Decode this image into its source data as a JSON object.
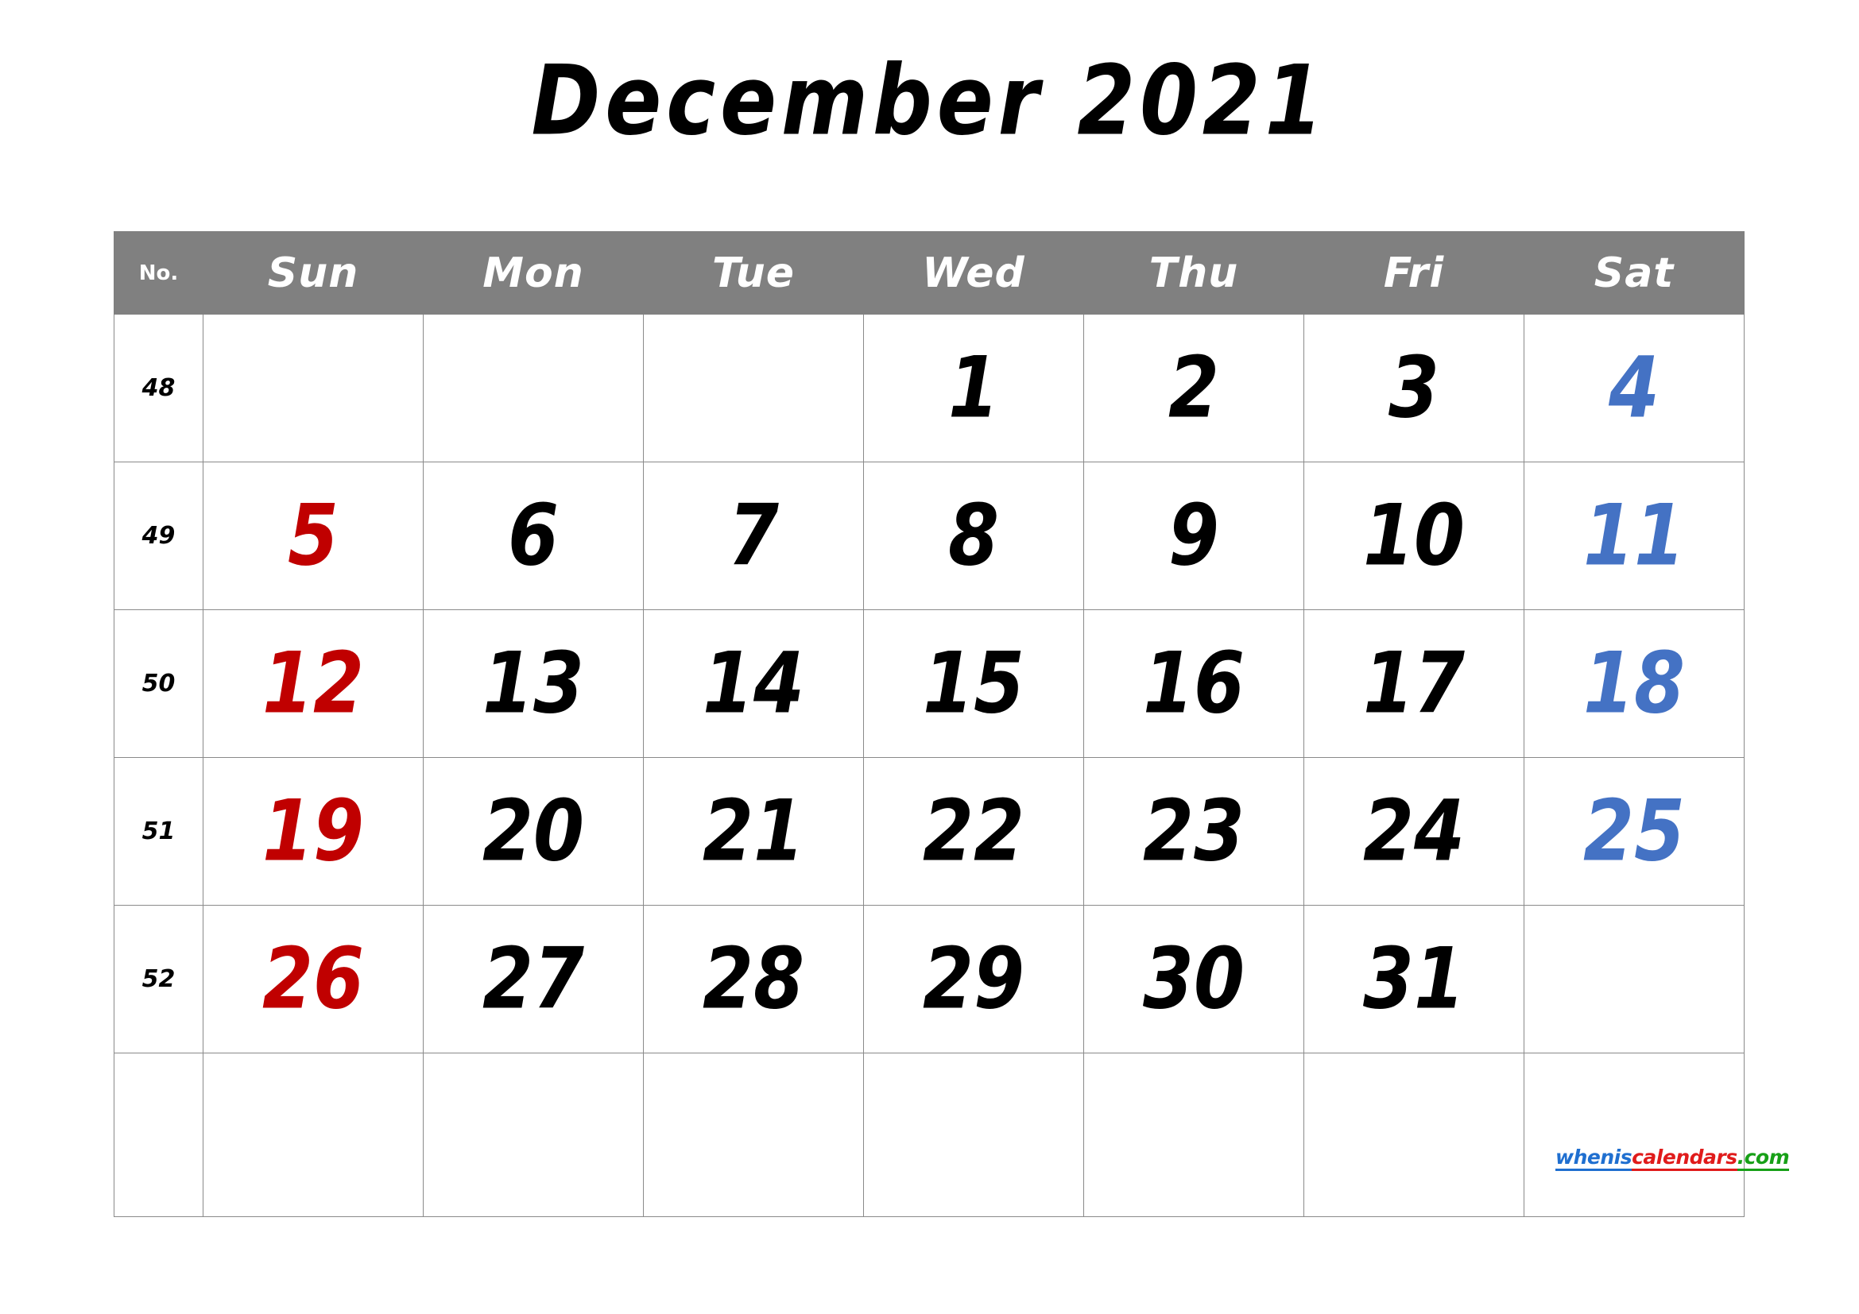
{
  "title": "December 2021",
  "colors": {
    "header_bg": "#808080",
    "header_text": "#ffffff",
    "sunday": "#C00000",
    "saturday": "#4472C4",
    "weekday": "#000000",
    "grid_line": "#8a8a8a",
    "page_bg": "#ffffff"
  },
  "header": {
    "week_no_label": "No.",
    "days": [
      "Sun",
      "Mon",
      "Tue",
      "Wed",
      "Thu",
      "Fri",
      "Sat"
    ]
  },
  "weeks": [
    {
      "no": "48",
      "cells": [
        {
          "day": "",
          "kind": "empty"
        },
        {
          "day": "",
          "kind": "empty"
        },
        {
          "day": "",
          "kind": "empty"
        },
        {
          "day": "1",
          "kind": "weekday"
        },
        {
          "day": "2",
          "kind": "weekday"
        },
        {
          "day": "3",
          "kind": "weekday"
        },
        {
          "day": "4",
          "kind": "sat"
        }
      ]
    },
    {
      "no": "49",
      "cells": [
        {
          "day": "5",
          "kind": "sun"
        },
        {
          "day": "6",
          "kind": "weekday"
        },
        {
          "day": "7",
          "kind": "weekday"
        },
        {
          "day": "8",
          "kind": "weekday"
        },
        {
          "day": "9",
          "kind": "weekday"
        },
        {
          "day": "10",
          "kind": "weekday"
        },
        {
          "day": "11",
          "kind": "sat"
        }
      ]
    },
    {
      "no": "50",
      "cells": [
        {
          "day": "12",
          "kind": "sun"
        },
        {
          "day": "13",
          "kind": "weekday"
        },
        {
          "day": "14",
          "kind": "weekday"
        },
        {
          "day": "15",
          "kind": "weekday"
        },
        {
          "day": "16",
          "kind": "weekday"
        },
        {
          "day": "17",
          "kind": "weekday"
        },
        {
          "day": "18",
          "kind": "sat"
        }
      ]
    },
    {
      "no": "51",
      "cells": [
        {
          "day": "19",
          "kind": "sun"
        },
        {
          "day": "20",
          "kind": "weekday"
        },
        {
          "day": "21",
          "kind": "weekday"
        },
        {
          "day": "22",
          "kind": "weekday"
        },
        {
          "day": "23",
          "kind": "weekday"
        },
        {
          "day": "24",
          "kind": "weekday"
        },
        {
          "day": "25",
          "kind": "sat"
        }
      ]
    },
    {
      "no": "52",
      "cells": [
        {
          "day": "26",
          "kind": "sun"
        },
        {
          "day": "27",
          "kind": "weekday"
        },
        {
          "day": "28",
          "kind": "weekday"
        },
        {
          "day": "29",
          "kind": "weekday"
        },
        {
          "day": "30",
          "kind": "weekday"
        },
        {
          "day": "31",
          "kind": "weekday"
        },
        {
          "day": "",
          "kind": "empty"
        }
      ]
    },
    {
      "no": "",
      "cells": [
        {
          "day": "",
          "kind": "empty"
        },
        {
          "day": "",
          "kind": "empty"
        },
        {
          "day": "",
          "kind": "empty"
        },
        {
          "day": "",
          "kind": "empty"
        },
        {
          "day": "",
          "kind": "empty"
        },
        {
          "day": "",
          "kind": "empty"
        },
        {
          "day": "",
          "kind": "empty"
        }
      ]
    }
  ],
  "watermark": {
    "part1": "whenis",
    "part2": "calendars",
    "part3": ".com"
  }
}
